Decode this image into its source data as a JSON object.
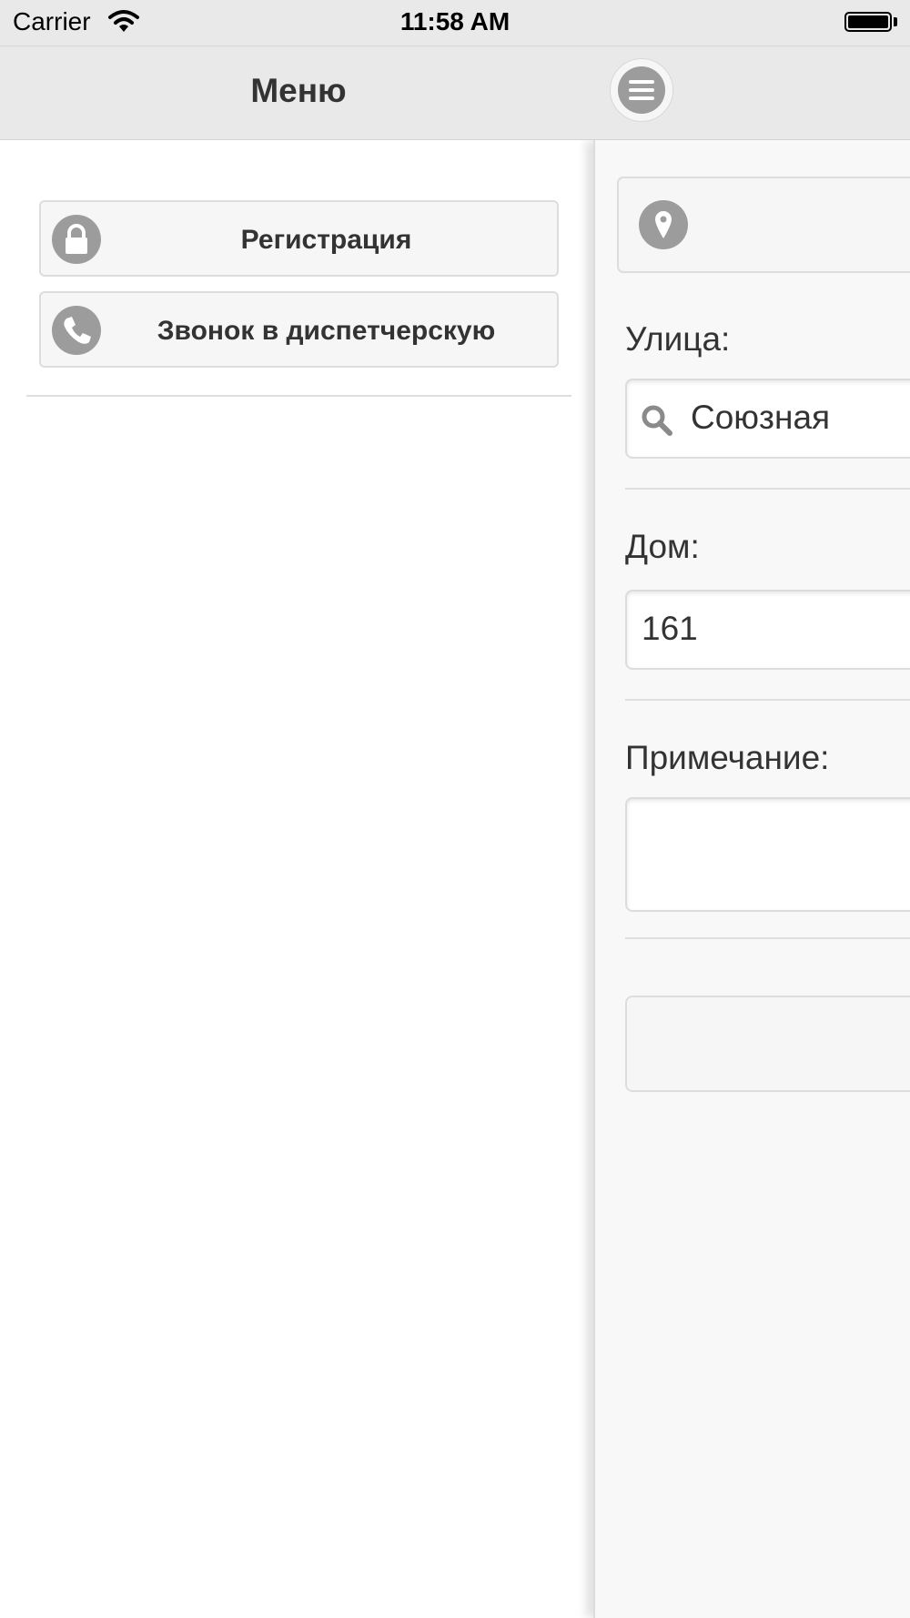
{
  "status_bar": {
    "carrier": "Carrier",
    "time": "11:58 AM",
    "battery_level": 1.0
  },
  "header": {
    "title": "Меню",
    "menu_button_icon": "hamburger-icon"
  },
  "side_panel": {
    "items": [
      {
        "label": "Регистрация",
        "icon": "lock-icon"
      },
      {
        "label": "Звонок в диспетчерскую",
        "icon": "phone-icon"
      }
    ]
  },
  "form": {
    "location_button_icon": "location-pin-icon",
    "street": {
      "label": "Улица:",
      "value": "Союзная",
      "icon": "search-icon"
    },
    "house": {
      "label": "Дом:",
      "value": "161"
    },
    "note": {
      "label": "Примечание:",
      "value": ""
    }
  },
  "colors": {
    "bar_background": "#e9e9e9",
    "icon_gray": "#9c9c9c",
    "text": "#333333",
    "button_background": "#f6f6f6"
  }
}
